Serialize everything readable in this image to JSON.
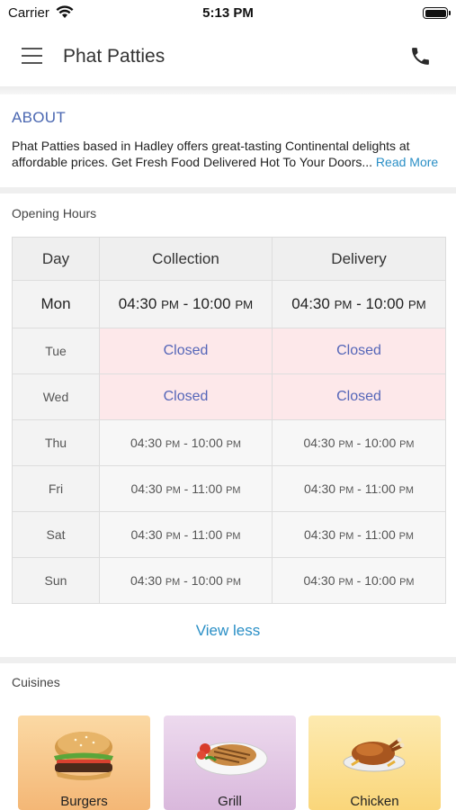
{
  "status": {
    "carrier": "Carrier",
    "time": "5:13 PM"
  },
  "header": {
    "title": "Phat Patties",
    "menu_icon": "hamburger-menu-icon",
    "call_icon": "phone-icon"
  },
  "about": {
    "title": "ABOUT",
    "text": "Phat Patties based in Hadley offers great-tasting Continental delights at affordable prices. Get Fresh Food Delivered Hot To Your Doors...",
    "read_more": "Read More"
  },
  "opening_hours": {
    "label": "Opening Hours",
    "columns": [
      "Day",
      "Collection",
      "Delivery"
    ],
    "rows": [
      {
        "day": "Mon",
        "collection": {
          "from": "04:30",
          "from_suffix": "PM",
          "to": "10:00",
          "to_suffix": "PM"
        },
        "delivery": {
          "from": "04:30",
          "from_suffix": "PM",
          "to": "10:00",
          "to_suffix": "PM"
        }
      },
      {
        "day": "Tue",
        "collection_closed": "Closed",
        "delivery_closed": "Closed"
      },
      {
        "day": "Wed",
        "collection_closed": "Closed",
        "delivery_closed": "Closed"
      },
      {
        "day": "Thu",
        "collection": {
          "from": "04:30",
          "from_suffix": "PM",
          "to": "10:00",
          "to_suffix": "PM"
        },
        "delivery": {
          "from": "04:30",
          "from_suffix": "PM",
          "to": "10:00",
          "to_suffix": "PM"
        }
      },
      {
        "day": "Fri",
        "collection": {
          "from": "04:30",
          "from_suffix": "PM",
          "to": "11:00",
          "to_suffix": "PM"
        },
        "delivery": {
          "from": "04:30",
          "from_suffix": "PM",
          "to": "11:00",
          "to_suffix": "PM"
        }
      },
      {
        "day": "Sat",
        "collection": {
          "from": "04:30",
          "from_suffix": "PM",
          "to": "11:00",
          "to_suffix": "PM"
        },
        "delivery": {
          "from": "04:30",
          "from_suffix": "PM",
          "to": "11:00",
          "to_suffix": "PM"
        }
      },
      {
        "day": "Sun",
        "collection": {
          "from": "04:30",
          "from_suffix": "PM",
          "to": "10:00",
          "to_suffix": "PM"
        },
        "delivery": {
          "from": "04:30",
          "from_suffix": "PM",
          "to": "10:00",
          "to_suffix": "PM"
        }
      }
    ],
    "view_less": "View less"
  },
  "cuisines": {
    "label": "Cuisines",
    "items": [
      {
        "label": "Burgers",
        "icon": "burger-icon",
        "color": "#f7c98b"
      },
      {
        "label": "Grill",
        "icon": "grilled-food-icon",
        "color": "#e4cde6"
      },
      {
        "label": "Chicken",
        "icon": "roast-chicken-icon",
        "color": "#fde08f"
      }
    ]
  },
  "colors": {
    "accent_link": "#2a8fc6",
    "about_title": "#4a67b1",
    "closed_bg": "#fde8ea",
    "closed_text": "#5566b8"
  }
}
